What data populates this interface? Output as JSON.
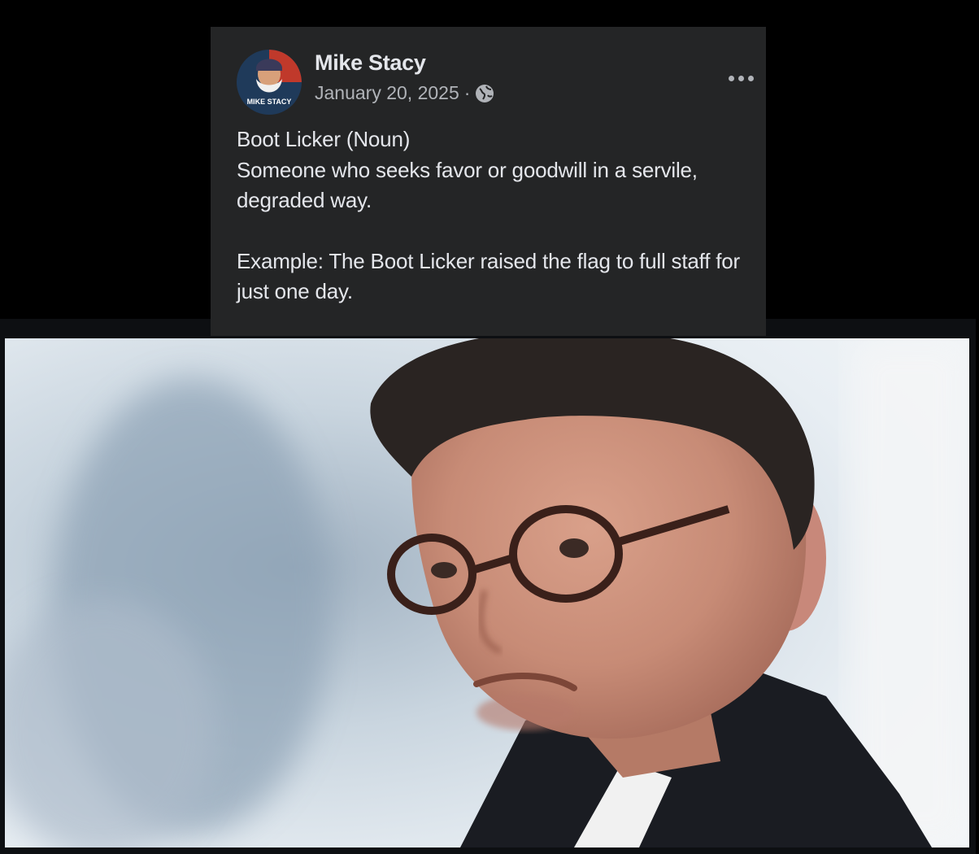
{
  "post": {
    "author": "Mike Stacy",
    "date": "January 20, 2025",
    "separator": "·",
    "privacy_icon": "globe-icon",
    "more_icon": "more-options-icon",
    "avatar_text": "MIKE STACY",
    "text": {
      "line1": "Boot Licker (Noun)",
      "line2": "Someone who seeks favor or goodwill in a servile, degraded way.",
      "line3": "Example: The Boot Licker raised the flag to full staff for just one day."
    }
  },
  "colors": {
    "card_bg": "#242526",
    "text_primary": "#e4e6eb",
    "text_secondary": "#b0b3b8",
    "page_bg": "#000000"
  },
  "photo": {
    "subject": "man-with-glasses-portrait"
  }
}
